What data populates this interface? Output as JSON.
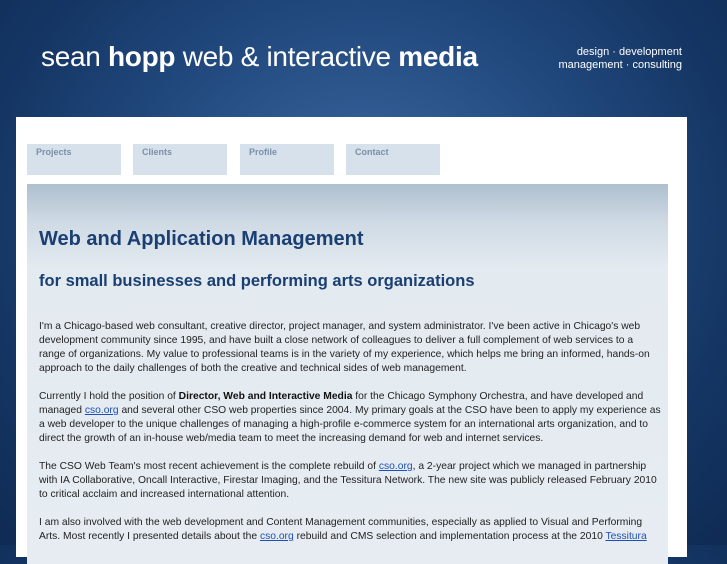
{
  "header": {
    "logo_part1": "sean ",
    "logo_bold1": "hopp",
    "logo_part2": " web & interactive ",
    "logo_bold2": "media",
    "tagline_line1": "design · development",
    "tagline_line2": "management · consulting"
  },
  "nav": {
    "tabs": [
      {
        "label": "Projects"
      },
      {
        "label": "Clients"
      },
      {
        "label": "Profile"
      },
      {
        "label": "Contact"
      }
    ]
  },
  "main": {
    "title": "Web and Application Management",
    "subtitle": "for small businesses and performing arts organizations",
    "p1": "I'm a Chicago-based web consultant, creative director, project manager, and system administrator. I've been active in Chicago's web development community since 1995, and have built a close network of colleagues to deliver a full complement of web services to a range of organizations. My value to professional teams is in the variety of my experience, which helps me bring an informed, hands-on approach to the daily challenges of both the creative and technical sides of web management.",
    "p2_a": "Currently I hold the position of ",
    "p2_bold": "Director, Web and Interactive Media",
    "p2_b": " for the Chicago Symphony Orchestra, and have developed and managed ",
    "p2_link": "cso.org",
    "p2_c": " and several other CSO web properties since 2004. My primary goals at the CSO have been to apply my experience as a web developer to the unique challenges of managing a high-profile e-commerce system for an international arts organization, and to direct the growth of an in-house web/media team to meet the increasing demand for web and internet services.",
    "p3_a": "The CSO Web Team's most recent achievement is the complete rebuild of ",
    "p3_link": "cso.org",
    "p3_b": ", a 2-year project which we managed in partnership with IA Collaborative, Oncall Interactive, Firestar Imaging, and the Tessitura Network. The new site was publicly released February 2010 to critical acclaim and increased international attention.",
    "p4_a": "I am also involved with the web development and Content Management communities, especially as applied to Visual and Performing Arts. Most recently I presented details about the ",
    "p4_link": "cso.org",
    "p4_b": " rebuild and CMS selection and implementation process at the 2010 ",
    "p4_link2": "Tessitura"
  }
}
